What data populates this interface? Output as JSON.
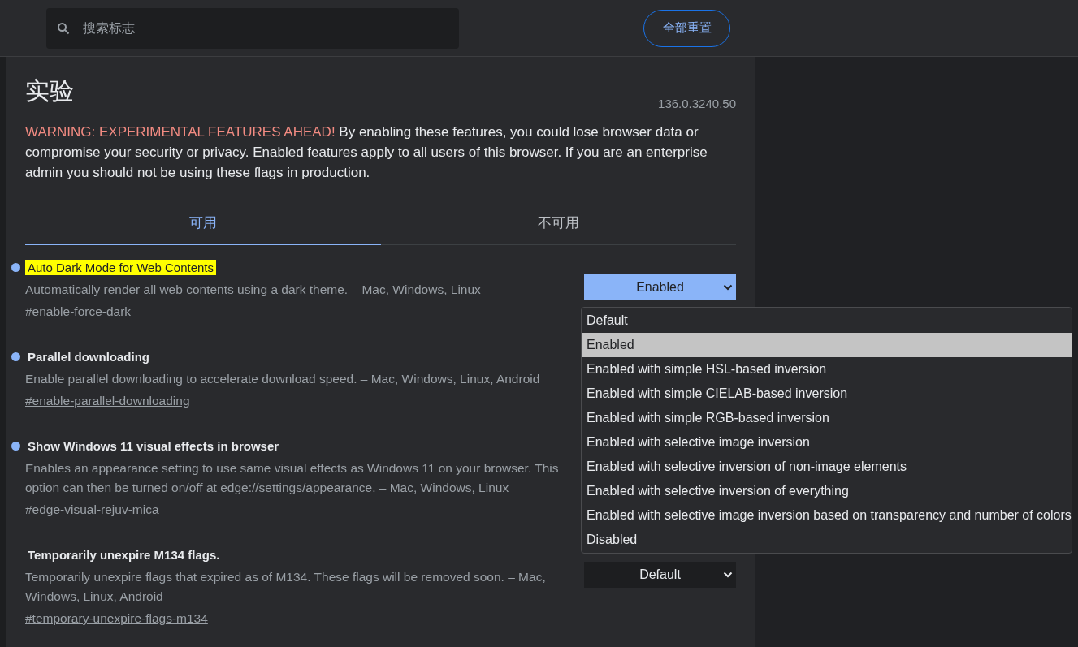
{
  "search": {
    "placeholder": "搜索标志"
  },
  "reset_button": "全部重置",
  "title": "实验",
  "version": "136.0.3240.50",
  "warning": {
    "label": "WARNING: EXPERIMENTAL FEATURES AHEAD!",
    "text": "By enabling these features, you could lose browser data or compromise your security or privacy. Enabled features apply to all users of this browser. If you are an enterprise admin you should not be using these flags in production."
  },
  "tabs": [
    {
      "label": "可用",
      "selected": true
    },
    {
      "label": "不可用",
      "selected": false
    }
  ],
  "flags": [
    {
      "title": "Auto Dark Mode for Web Contents",
      "highlighted": true,
      "modified": true,
      "description": "Automatically render all web contents using a dark theme. – Mac, Windows, Linux",
      "link": "#enable-force-dark",
      "select": {
        "value": "Enabled",
        "enabled": true
      }
    },
    {
      "title": "Parallel downloading",
      "highlighted": false,
      "modified": true,
      "description": "Enable parallel downloading to accelerate download speed. – Mac, Windows, Linux, Android",
      "link": "#enable-parallel-downloading"
    },
    {
      "title": "Show Windows 11 visual effects in browser",
      "highlighted": false,
      "modified": true,
      "description": "Enables an appearance setting to use same visual effects as Windows 11 on your browser. This option can then be turned on/off at edge://settings/appearance. – Mac, Windows, Linux",
      "link": "#edge-visual-rejuv-mica"
    },
    {
      "title": "Temporarily unexpire M134 flags.",
      "highlighted": false,
      "modified": false,
      "description": "Temporarily unexpire flags that expired as of M134. These flags will be removed soon. – Mac, Windows, Linux, Android",
      "link": "#temporary-unexpire-flags-m134",
      "select": {
        "value": "Default",
        "enabled": false
      }
    }
  ],
  "dropdown": {
    "options": [
      {
        "label": "Default",
        "selected": false
      },
      {
        "label": "Enabled",
        "selected": true
      },
      {
        "label": "Enabled with simple HSL-based inversion",
        "selected": false
      },
      {
        "label": "Enabled with simple CIELAB-based inversion",
        "selected": false
      },
      {
        "label": "Enabled with simple RGB-based inversion",
        "selected": false
      },
      {
        "label": "Enabled with selective image inversion",
        "selected": false
      },
      {
        "label": "Enabled with selective inversion of non-image elements",
        "selected": false
      },
      {
        "label": "Enabled with selective inversion of everything",
        "selected": false
      },
      {
        "label": "Enabled with selective image inversion based on transparency and number of colors",
        "selected": false
      },
      {
        "label": "Disabled",
        "selected": false
      }
    ]
  }
}
